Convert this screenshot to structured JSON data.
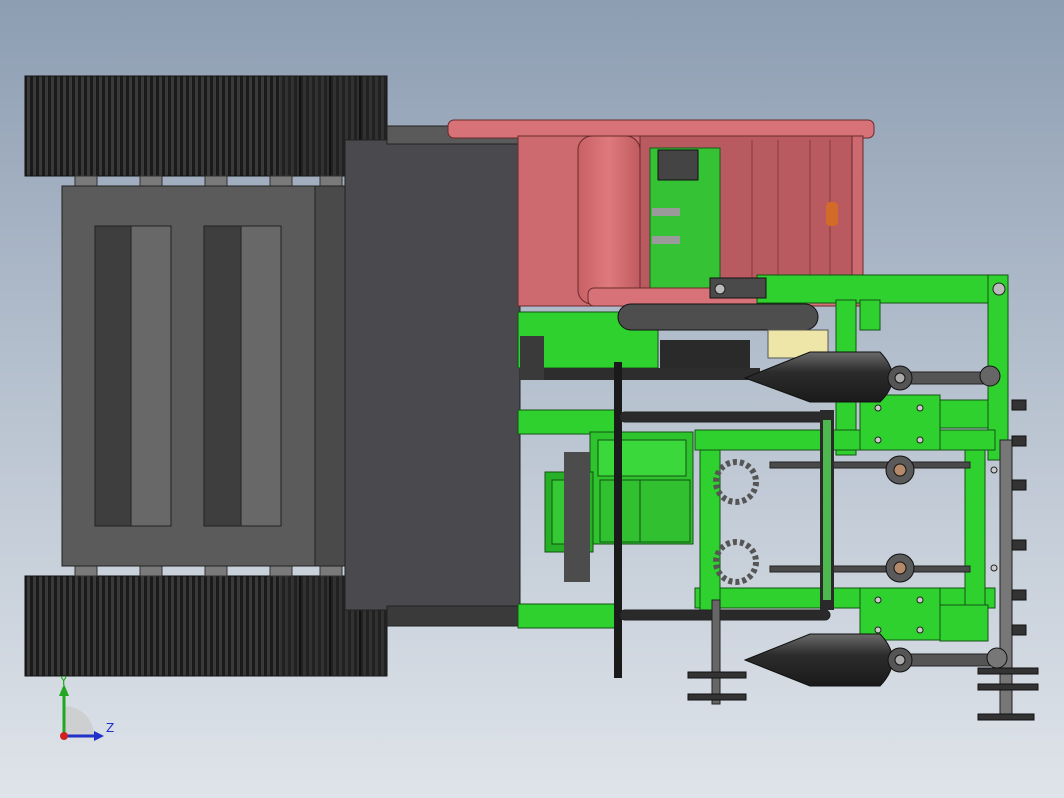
{
  "viewport": {
    "background_top": "#8d9db2",
    "background_bottom": "#dfe4ea"
  },
  "colors": {
    "frame_green": "#2fd12f",
    "frame_green_dark": "#1f9e1f",
    "hopper_red": "#d2676b",
    "track_dark": "#2e2e2e",
    "body_gray": "#5a5a5a",
    "axis_y": "#1fa81f",
    "axis_z": "#2030c8"
  },
  "triad": {
    "y_label": "Y",
    "z_label": "Z"
  }
}
